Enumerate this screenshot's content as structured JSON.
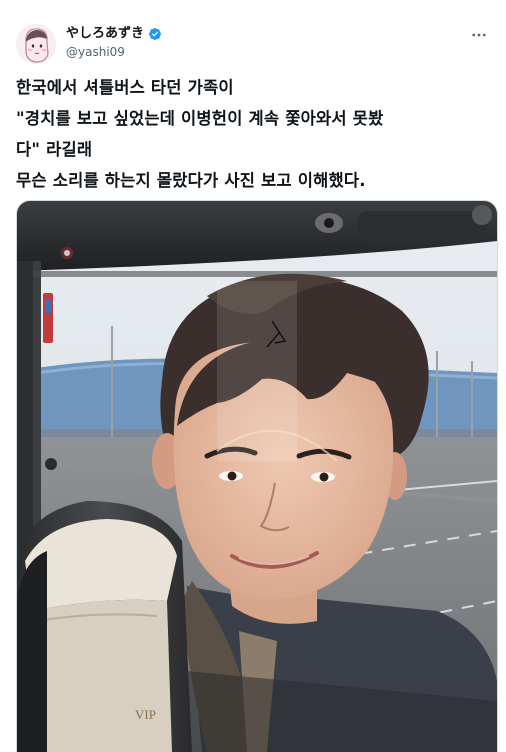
{
  "user": {
    "display_name": "やしろあずき",
    "handle": "@yashi09",
    "verified": true,
    "avatar_icon": "avatar-face-icon"
  },
  "menu_icon": "more-options-icon",
  "tweet": {
    "lines": [
      "한국에서 셔틀버스 타던 가족이",
      "\"경치를 보고 싶었는데  이병헌이 계속 쫓아와서 못봤",
      "다\" 라길래",
      "무슨 소리를 하는지 몰랐다가 사진 보고 이해했다."
    ]
  },
  "photo": {
    "seat_tag_text": "VIP"
  },
  "colors": {
    "verified_blue": "#1d9bf0",
    "text": "#0f1419",
    "secondary": "#536471"
  }
}
